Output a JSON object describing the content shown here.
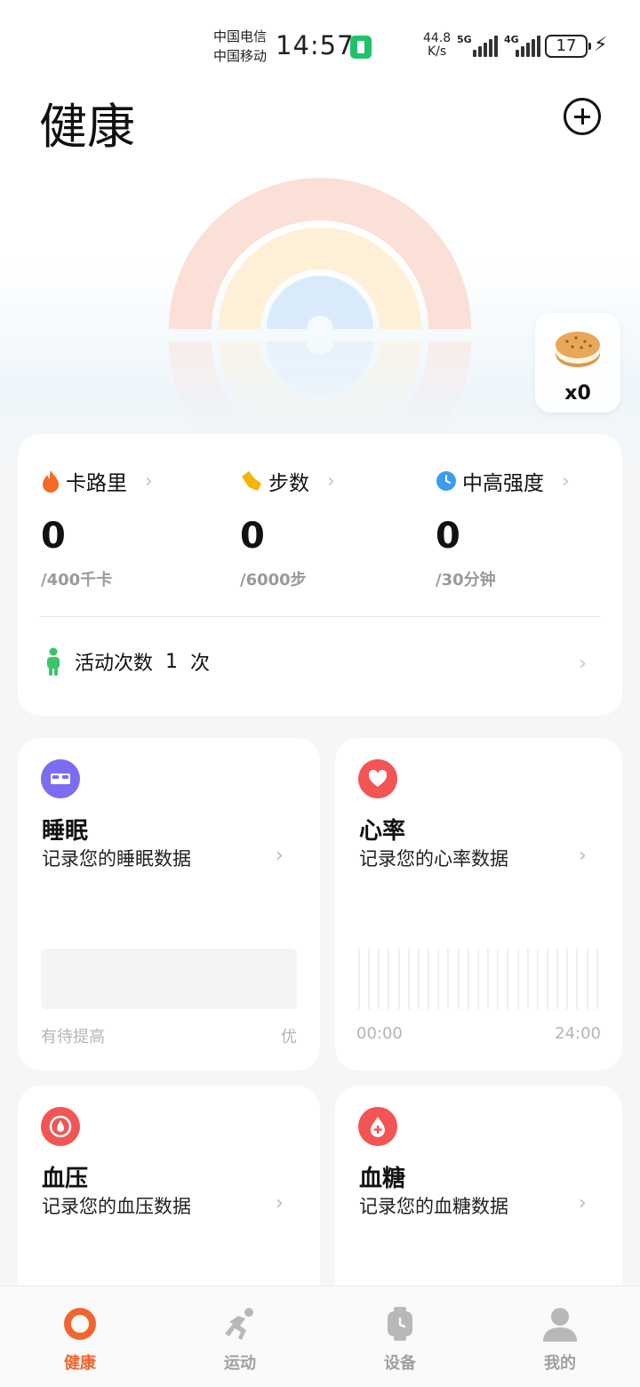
{
  "status_bar": {
    "carrier_1": "中国电信",
    "carrier_2": "中国移动",
    "time": "14:57",
    "net_speed_value": "44.8",
    "net_speed_unit": "K/s",
    "network_1": "5G",
    "network_2": "4G",
    "battery": "17"
  },
  "header": {
    "title": "健康"
  },
  "cookie": {
    "count": "x0"
  },
  "summary": {
    "metrics": [
      {
        "label": "卡路里",
        "value": "0",
        "target": "/400千卡",
        "icon": "flame-icon",
        "color": "#f36a22"
      },
      {
        "label": "步数",
        "value": "0",
        "target": "/6000步",
        "icon": "shoe-icon",
        "color": "#f5b400"
      },
      {
        "label": "中高强度",
        "value": "0",
        "target": "/30分钟",
        "icon": "clock-icon",
        "color": "#3d9cf0"
      }
    ],
    "activity_label": "活动次数",
    "activity_count": "1",
    "activity_unit": "次"
  },
  "tiles": {
    "sleep": {
      "title": "睡眠",
      "subtitle": "记录您的睡眠数据",
      "left_label": "有待提高",
      "right_label": "优",
      "icon_color": "#7b6cf0"
    },
    "heart": {
      "title": "心率",
      "subtitle": "记录您的心率数据",
      "start_label": "00:00",
      "end_label": "24:00",
      "icon_color": "#f35454"
    },
    "pressure": {
      "title": "血压",
      "subtitle": "记录您的血压数据",
      "icon_color": "#f35454"
    },
    "glucose": {
      "title": "血糖",
      "subtitle": "记录您的血糖数据",
      "icon_color": "#f35454"
    }
  },
  "nav": {
    "items": [
      {
        "label": "健康",
        "active": true
      },
      {
        "label": "运动",
        "active": false
      },
      {
        "label": "设备",
        "active": false
      },
      {
        "label": "我的",
        "active": false
      }
    ],
    "active_color": "#f2662e"
  }
}
